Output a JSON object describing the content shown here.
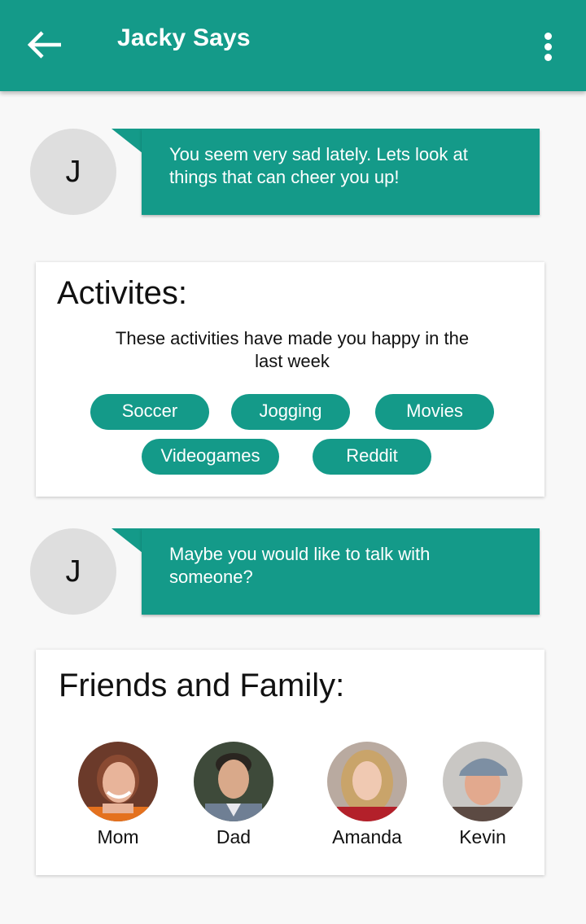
{
  "appbar": {
    "title": "Jacky Says",
    "back_icon": "arrow-left-icon",
    "menu_icon": "more-vertical-icon"
  },
  "messages": [
    {
      "avatar_letter": "J",
      "text": "You seem very sad lately. Lets look at things that can cheer you up!"
    },
    {
      "avatar_letter": "J",
      "text": "Maybe you would like to talk with someone?"
    }
  ],
  "activities": {
    "title": "Activites:",
    "subtitle": "These activities have made you happy in the last week",
    "chips": [
      "Soccer",
      "Jogging",
      "Movies",
      "Videogames",
      "Reddit"
    ]
  },
  "friends": {
    "title": "Friends and Family:",
    "people": [
      {
        "name": "Mom",
        "photo": "woman-portrait"
      },
      {
        "name": "Dad",
        "photo": "man-portrait"
      },
      {
        "name": "Amanda",
        "photo": "woman-portrait"
      },
      {
        "name": "Kevin",
        "photo": "man-cap-portrait"
      }
    ]
  },
  "colors": {
    "accent": "#149a89",
    "background": "#f8f8f8",
    "avatar_bg": "#dedede"
  }
}
